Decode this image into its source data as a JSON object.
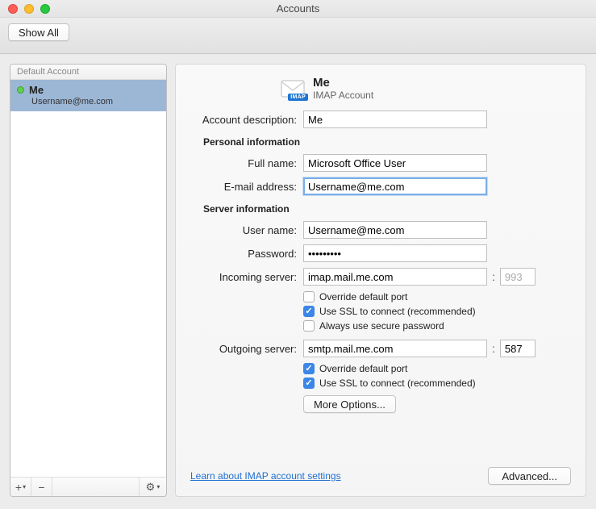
{
  "window": {
    "title": "Accounts"
  },
  "toolbar": {
    "show_all": "Show All"
  },
  "sidebar": {
    "header": "Default Account",
    "account": {
      "name": "Me",
      "email": "Username@me.com"
    },
    "footer": {
      "add": "+",
      "remove": "−",
      "gear": "⚙"
    }
  },
  "main": {
    "heading": {
      "name": "Me",
      "type": "IMAP Account",
      "badge": "IMAP"
    },
    "labels": {
      "description": "Account description:",
      "personal_info": "Personal information",
      "full_name": "Full name:",
      "email": "E-mail address:",
      "server_info": "Server information",
      "user_name": "User name:",
      "password": "Password:",
      "incoming": "Incoming server:",
      "outgoing": "Outgoing server:",
      "override_port": "Override default port",
      "use_ssl": "Use SSL to connect (recommended)",
      "secure_pw": "Always use secure password",
      "more_options": "More Options...",
      "learn_link": "Learn about IMAP account settings",
      "advanced": "Advanced..."
    },
    "values": {
      "description": "Me",
      "full_name": "Microsoft Office User",
      "email": "Username@me.com",
      "user_name": "Username@me.com",
      "password": "•••••••••",
      "incoming_server": "imap.mail.me.com",
      "incoming_port": "993",
      "outgoing_server": "smtp.mail.me.com",
      "outgoing_port": "587"
    },
    "checks": {
      "in_override": false,
      "in_ssl": true,
      "in_secure_pw": false,
      "out_override": true,
      "out_ssl": true
    }
  }
}
